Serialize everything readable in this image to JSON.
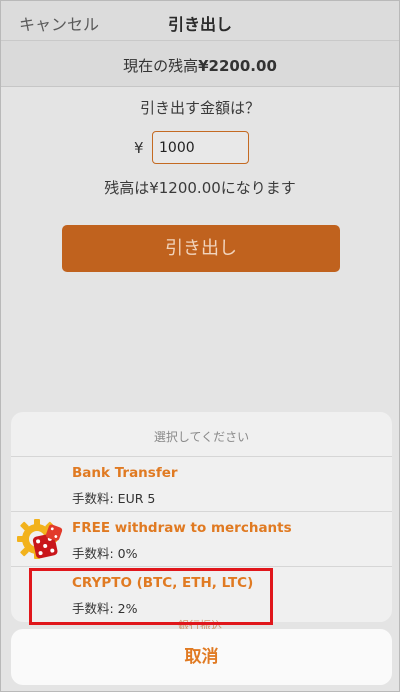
{
  "nav": {
    "cancel_label": "キャンセル",
    "title": "引き出し"
  },
  "balance": {
    "label": "現在の残高",
    "amount": "¥2200.00"
  },
  "form": {
    "question": "引き出す金額は？",
    "currency_symbol": "¥",
    "amount_value": "1000",
    "remaining_text": "残高は¥1200.00になります",
    "submit_label": "引き出し"
  },
  "action_sheet": {
    "header": "選択してください",
    "options": [
      {
        "title": "Bank Transfer",
        "fee": "手数料: EUR 5",
        "icon": "none"
      },
      {
        "title": "FREE withdraw to merchants",
        "fee": "手数料: 0%",
        "icon": "casino-dice-gear-icon"
      },
      {
        "title": "CRYPTO (BTC, ETH, LTC)",
        "fee": "手数料: 2%",
        "icon": "none"
      }
    ],
    "peek_text": "銀行振込",
    "cancel_label": "取消"
  },
  "colors": {
    "accent": "#e07a22",
    "button": "#c0621e",
    "highlight": "#e0161b"
  }
}
